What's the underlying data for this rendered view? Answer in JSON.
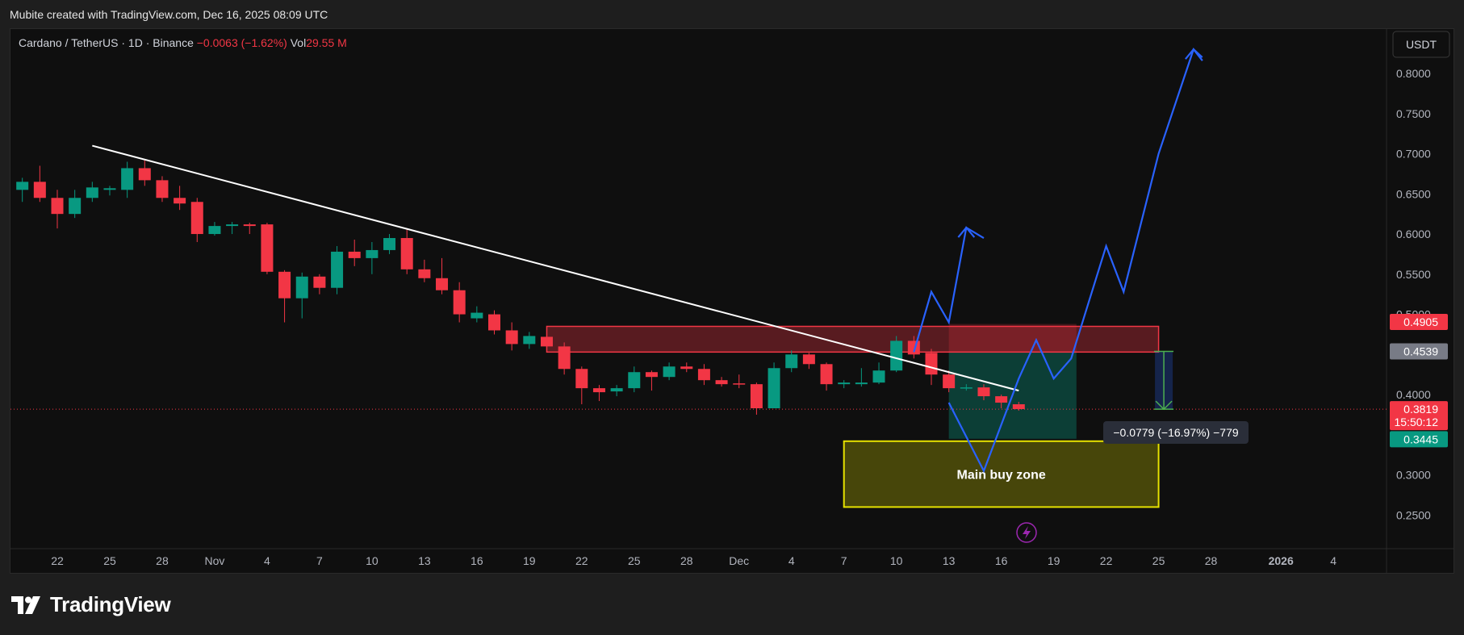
{
  "header": {
    "snapshot_text": "Mubite created with TradingView.com, Dec 16, 2025 08:09 UTC"
  },
  "legend": {
    "symbol": "Cardano / TetherUS · 1D · Binance",
    "change": "−0.0063 (−1.62%)",
    "vol_label": "Vol",
    "vol_value": "29.55 M"
  },
  "currency_button": "USDT",
  "branding": {
    "logo_text": "TradingView"
  },
  "colors": {
    "up": "#089981",
    "down": "#f23645",
    "trendline": "#ffffff",
    "projection": "#2962ff",
    "resistance_zone": "#f23645",
    "buy_zone": "#c9c600",
    "short_target": "#22ab94"
  },
  "chart_data": {
    "type": "candlestick",
    "ylim": [
      0.22,
      0.875
    ],
    "y_ticks": [
      "0.8000",
      "0.7500",
      "0.7000",
      "0.6500",
      "0.6000",
      "0.5500",
      "0.5000",
      "0.4000",
      "0.3000",
      "0.2500"
    ],
    "x_ticks": [
      {
        "day": 22,
        "label": "22"
      },
      {
        "day": 25,
        "label": "25"
      },
      {
        "day": 28,
        "label": "28"
      },
      {
        "day": 31,
        "label": "Nov"
      },
      {
        "day": 34,
        "label": "4"
      },
      {
        "day": 37,
        "label": "7"
      },
      {
        "day": 40,
        "label": "10"
      },
      {
        "day": 43,
        "label": "13"
      },
      {
        "day": 46,
        "label": "16"
      },
      {
        "day": 49,
        "label": "19"
      },
      {
        "day": 52,
        "label": "22"
      },
      {
        "day": 55,
        "label": "25"
      },
      {
        "day": 58,
        "label": "28"
      },
      {
        "day": 61,
        "label": "Dec"
      },
      {
        "day": 64,
        "label": "4"
      },
      {
        "day": 67,
        "label": "7"
      },
      {
        "day": 70,
        "label": "10"
      },
      {
        "day": 73,
        "label": "13"
      },
      {
        "day": 76,
        "label": "16"
      },
      {
        "day": 79,
        "label": "19"
      },
      {
        "day": 82,
        "label": "22"
      },
      {
        "day": 85,
        "label": "25"
      },
      {
        "day": 88,
        "label": "28"
      },
      {
        "day": 92,
        "label": "2026"
      },
      {
        "day": 95,
        "label": "4"
      }
    ],
    "candles": [
      {
        "d": 20,
        "o": 0.655,
        "h": 0.67,
        "l": 0.64,
        "c": 0.665
      },
      {
        "d": 21,
        "o": 0.665,
        "h": 0.685,
        "l": 0.64,
        "c": 0.645
      },
      {
        "d": 22,
        "o": 0.645,
        "h": 0.655,
        "l": 0.607,
        "c": 0.625
      },
      {
        "d": 23,
        "o": 0.625,
        "h": 0.655,
        "l": 0.62,
        "c": 0.645
      },
      {
        "d": 24,
        "o": 0.645,
        "h": 0.665,
        "l": 0.64,
        "c": 0.658
      },
      {
        "d": 25,
        "o": 0.655,
        "h": 0.66,
        "l": 0.648,
        "c": 0.657
      },
      {
        "d": 26,
        "o": 0.655,
        "h": 0.69,
        "l": 0.645,
        "c": 0.682
      },
      {
        "d": 27,
        "o": 0.682,
        "h": 0.692,
        "l": 0.66,
        "c": 0.667
      },
      {
        "d": 28,
        "o": 0.667,
        "h": 0.672,
        "l": 0.64,
        "c": 0.645
      },
      {
        "d": 29,
        "o": 0.645,
        "h": 0.66,
        "l": 0.63,
        "c": 0.638
      },
      {
        "d": 30,
        "o": 0.64,
        "h": 0.645,
        "l": 0.59,
        "c": 0.6
      },
      {
        "d": 31,
        "o": 0.6,
        "h": 0.615,
        "l": 0.598,
        "c": 0.61
      },
      {
        "d": 32,
        "o": 0.61,
        "h": 0.615,
        "l": 0.6,
        "c": 0.612
      },
      {
        "d": 33,
        "o": 0.612,
        "h": 0.614,
        "l": 0.6,
        "c": 0.61
      },
      {
        "d": 34,
        "o": 0.612,
        "h": 0.614,
        "l": 0.55,
        "c": 0.553
      },
      {
        "d": 35,
        "o": 0.553,
        "h": 0.555,
        "l": 0.49,
        "c": 0.52
      },
      {
        "d": 36,
        "o": 0.52,
        "h": 0.552,
        "l": 0.495,
        "c": 0.547
      },
      {
        "d": 37,
        "o": 0.547,
        "h": 0.55,
        "l": 0.525,
        "c": 0.533
      },
      {
        "d": 38,
        "o": 0.533,
        "h": 0.585,
        "l": 0.525,
        "c": 0.578
      },
      {
        "d": 39,
        "o": 0.578,
        "h": 0.593,
        "l": 0.56,
        "c": 0.57
      },
      {
        "d": 40,
        "o": 0.57,
        "h": 0.59,
        "l": 0.55,
        "c": 0.58
      },
      {
        "d": 41,
        "o": 0.58,
        "h": 0.6,
        "l": 0.575,
        "c": 0.595
      },
      {
        "d": 42,
        "o": 0.595,
        "h": 0.607,
        "l": 0.55,
        "c": 0.556
      },
      {
        "d": 43,
        "o": 0.556,
        "h": 0.568,
        "l": 0.54,
        "c": 0.545
      },
      {
        "d": 44,
        "o": 0.545,
        "h": 0.57,
        "l": 0.525,
        "c": 0.53
      },
      {
        "d": 45,
        "o": 0.53,
        "h": 0.54,
        "l": 0.49,
        "c": 0.5
      },
      {
        "d": 46,
        "o": 0.495,
        "h": 0.51,
        "l": 0.49,
        "c": 0.502
      },
      {
        "d": 47,
        "o": 0.5,
        "h": 0.505,
        "l": 0.475,
        "c": 0.48
      },
      {
        "d": 48,
        "o": 0.48,
        "h": 0.49,
        "l": 0.455,
        "c": 0.463
      },
      {
        "d": 49,
        "o": 0.463,
        "h": 0.478,
        "l": 0.457,
        "c": 0.473
      },
      {
        "d": 50,
        "o": 0.472,
        "h": 0.474,
        "l": 0.455,
        "c": 0.46
      },
      {
        "d": 51,
        "o": 0.46,
        "h": 0.465,
        "l": 0.425,
        "c": 0.432
      },
      {
        "d": 52,
        "o": 0.432,
        "h": 0.435,
        "l": 0.388,
        "c": 0.408
      },
      {
        "d": 53,
        "o": 0.408,
        "h": 0.412,
        "l": 0.392,
        "c": 0.403
      },
      {
        "d": 54,
        "o": 0.404,
        "h": 0.412,
        "l": 0.398,
        "c": 0.408
      },
      {
        "d": 55,
        "o": 0.408,
        "h": 0.435,
        "l": 0.403,
        "c": 0.428
      },
      {
        "d": 56,
        "o": 0.428,
        "h": 0.43,
        "l": 0.405,
        "c": 0.422
      },
      {
        "d": 57,
        "o": 0.422,
        "h": 0.44,
        "l": 0.418,
        "c": 0.435
      },
      {
        "d": 58,
        "o": 0.435,
        "h": 0.44,
        "l": 0.428,
        "c": 0.432
      },
      {
        "d": 59,
        "o": 0.432,
        "h": 0.438,
        "l": 0.412,
        "c": 0.418
      },
      {
        "d": 60,
        "o": 0.418,
        "h": 0.422,
        "l": 0.41,
        "c": 0.413
      },
      {
        "d": 61,
        "o": 0.414,
        "h": 0.425,
        "l": 0.408,
        "c": 0.413
      },
      {
        "d": 62,
        "o": 0.413,
        "h": 0.415,
        "l": 0.375,
        "c": 0.383
      },
      {
        "d": 63,
        "o": 0.383,
        "h": 0.44,
        "l": 0.383,
        "c": 0.433
      },
      {
        "d": 64,
        "o": 0.433,
        "h": 0.455,
        "l": 0.428,
        "c": 0.45
      },
      {
        "d": 65,
        "o": 0.45,
        "h": 0.452,
        "l": 0.432,
        "c": 0.438
      },
      {
        "d": 66,
        "o": 0.438,
        "h": 0.44,
        "l": 0.405,
        "c": 0.413
      },
      {
        "d": 67,
        "o": 0.413,
        "h": 0.418,
        "l": 0.408,
        "c": 0.415
      },
      {
        "d": 68,
        "o": 0.413,
        "h": 0.433,
        "l": 0.41,
        "c": 0.415
      },
      {
        "d": 69,
        "o": 0.415,
        "h": 0.44,
        "l": 0.413,
        "c": 0.43
      },
      {
        "d": 70,
        "o": 0.43,
        "h": 0.473,
        "l": 0.428,
        "c": 0.467
      },
      {
        "d": 71,
        "o": 0.467,
        "h": 0.473,
        "l": 0.445,
        "c": 0.45
      },
      {
        "d": 72,
        "o": 0.452,
        "h": 0.457,
        "l": 0.412,
        "c": 0.425
      },
      {
        "d": 73,
        "o": 0.425,
        "h": 0.43,
        "l": 0.403,
        "c": 0.408
      },
      {
        "d": 74,
        "o": 0.408,
        "h": 0.413,
        "l": 0.405,
        "c": 0.409
      },
      {
        "d": 75,
        "o": 0.409,
        "h": 0.413,
        "l": 0.393,
        "c": 0.398
      },
      {
        "d": 76,
        "o": 0.398,
        "h": 0.4,
        "l": 0.383,
        "c": 0.39
      },
      {
        "d": 77,
        "o": 0.388,
        "h": 0.391,
        "l": 0.38,
        "c": 0.382
      }
    ],
    "trendline": [
      [
        24,
        0.71
      ],
      [
        77,
        0.405
      ]
    ],
    "projection_path_1": [
      [
        71,
        0.453
      ],
      [
        72,
        0.528
      ],
      [
        73,
        0.49
      ],
      [
        74,
        0.608
      ],
      [
        75,
        0.595
      ]
    ],
    "projection_path_2": [
      [
        73,
        0.39
      ],
      [
        75,
        0.305
      ],
      [
        77,
        0.42
      ],
      [
        78,
        0.468
      ],
      [
        79,
        0.42
      ],
      [
        80,
        0.445
      ],
      [
        82,
        0.585
      ],
      [
        83,
        0.528
      ],
      [
        85,
        0.7
      ],
      [
        87,
        0.83
      ],
      [
        87.5,
        0.82
      ]
    ],
    "resistance_zone": {
      "d0": 50,
      "d1": 85,
      "y0": 0.453,
      "y1": 0.485
    },
    "buy_zone": {
      "d0": 67,
      "d1": 85,
      "y0": 0.26,
      "y1": 0.342,
      "label": "Main buy zone"
    },
    "short_position": {
      "d0": 73,
      "d1": 80.3,
      "entry": 0.453,
      "stop": 0.488,
      "target": 0.345
    },
    "price_range_measure": {
      "d": 85.3,
      "from": 0.4539,
      "to": 0.3819,
      "label": "−0.0779 (−16.97%) −779"
    },
    "current_price": 0.3819,
    "price_labels": [
      {
        "value": 0.4905,
        "text": "0.4905",
        "color": "#f23645"
      },
      {
        "value": 0.4539,
        "text": "0.4539",
        "color": "#787b86"
      },
      {
        "value": 0.3819,
        "text": "0.3819",
        "sub": "15:50:12",
        "color": "#f23645"
      },
      {
        "value": 0.3445,
        "text": "0.3445",
        "color": "#089981"
      }
    ]
  }
}
